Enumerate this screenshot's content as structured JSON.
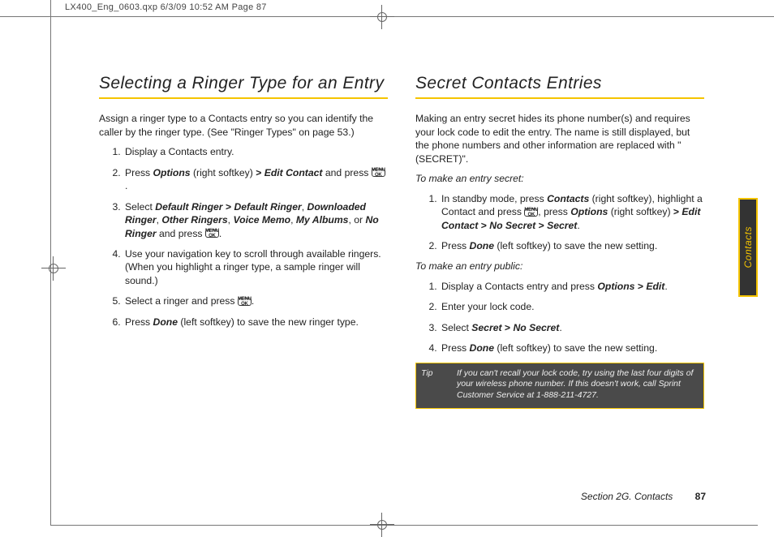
{
  "print_info": "LX400_Eng_0603.qxp  6/3/09  10:52 AM  Page 87",
  "sidetab": "Contacts",
  "footer": {
    "section": "Section 2G. Contacts",
    "page": "87"
  },
  "left": {
    "heading": "Selecting a Ringer Type for an Entry",
    "intro": "Assign a ringer type to a Contacts entry so you can identify the caller by the ringer type. (See \"Ringer Types\" on page 53.)",
    "steps": {
      "s1": "Display a Contacts entry.",
      "s2a": "Press ",
      "s2_opt": "Options",
      "s2b": " (right softkey) ",
      "s2_gt": ">",
      "s2_edit": "Edit Contact",
      "s2c": " and press ",
      "s3a": "Select ",
      "s3_dr": "Default Ringer",
      "s3_gt": ">",
      "s3_dr2": "Default Ringer",
      "s3b": ", ",
      "s3_dl": "Downloaded Ringer",
      "s3c": ", ",
      "s3_or": "Other Ringers",
      "s3d": ", ",
      "s3_vm": "Voice Memo",
      "s3e": ", ",
      "s3_ma": "My Albums",
      "s3f": ", or ",
      "s3_nr": "No Ringer",
      "s3g": " and press ",
      "s4": "Use your navigation key to scroll through available ringers. (When you highlight a ringer type, a sample ringer will sound.)",
      "s5a": "Select a ringer and press ",
      "s6a": "Press ",
      "s6_done": "Done",
      "s6b": " (left softkey) to save the new ringer type."
    }
  },
  "right": {
    "heading": "Secret Contacts Entries",
    "intro": "Making an entry secret hides its phone number(s) and requires your lock code to edit the entry. The name is still displayed, but the phone numbers and other information are replaced with \"(SECRET)\".",
    "sub1": "To make an entry secret:",
    "a1a": "In standby mode, press ",
    "a1_con": "Contacts",
    "a1b": " (right softkey), highlight a Contact and press ",
    "a1c": ", press ",
    "a1_opt": "Options",
    "a1d": " (right softkey) ",
    "a1_gt": ">",
    "a1_ec": "Edit Contact",
    "a1_gt2": ">",
    "a1_ns": "No Secret",
    "a1_gt3": ">",
    "a1_s": "Secret",
    "a1e": ".",
    "a2a": "Press ",
    "a2_done": "Done",
    "a2b": " (left softkey) to save the new setting.",
    "sub2": "To make an entry public:",
    "b1a": "Display a Contacts entry and press ",
    "b1_opt": "Options",
    "b1_gt": ">",
    "b1_ed": "Edit",
    "b1b": ".",
    "b2": "Enter your lock code.",
    "b3a": "Select ",
    "b3_s": "Secret",
    "b3_gt": ">",
    "b3_ns": "No Secret",
    "b3b": ".",
    "b4a": "Press ",
    "b4_done": "Done",
    "b4b": " (left softkey) to save the new setting.",
    "tip_label": "Tip",
    "tip_body": "If you can't recall your lock code, try using the last four digits of your wireless phone number. If this doesn't work, call Sprint Customer Service at 1-888-211-4727."
  },
  "key_label": "MENU OK"
}
